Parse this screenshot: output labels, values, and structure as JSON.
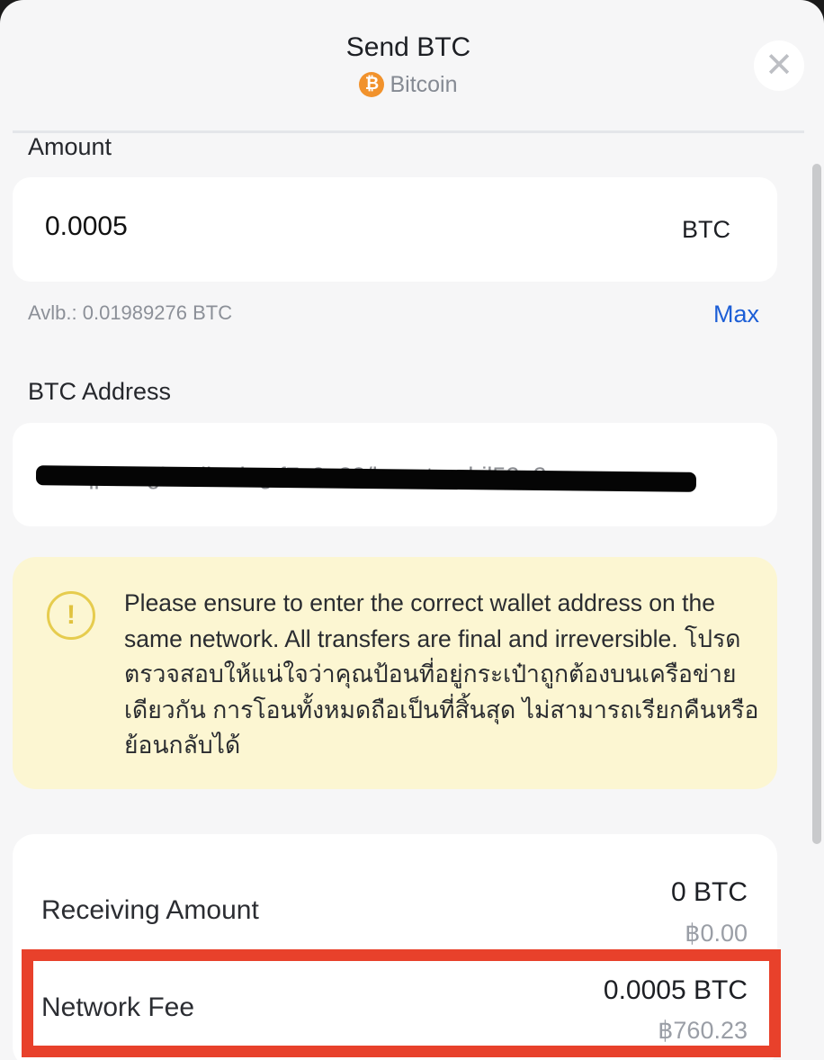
{
  "header": {
    "title": "Send BTC",
    "coin_symbol": "₿",
    "network_name": "Bitcoin",
    "close_glyph": "✕"
  },
  "amount": {
    "label": "Amount",
    "value": "0.0005",
    "unit": "BTC",
    "available": "Avlb.: 0.01989276 BTC",
    "max_label": "Max"
  },
  "address": {
    "label": "BTC Address",
    "value": "bc1qpz89gbxtdkedegtf7z2e33/buentpprbjl52g2"
  },
  "warning": {
    "icon_glyph": "!",
    "text": "Please ensure to enter the correct wallet address on the same network. All transfers are final and irreversible. โปรดตรวจสอบให้แน่ใจว่าคุณป้อนที่อยู่กระเป๋าถูกต้องบนเครือข่ายเดียวกัน การโอนทั้งหมดถือเป็นที่สิ้นสุด ไม่สามารถเรียกคืนหรือย้อนกลับได้"
  },
  "summary": {
    "receiving_label": "Receiving Amount",
    "receiving_btc": "0 BTC",
    "receiving_thb": "฿0.00",
    "fee_label": "Network Fee",
    "fee_btc": "0.0005 BTC",
    "fee_thb": "฿760.23"
  },
  "colors": {
    "accent_link": "#1c5ed6",
    "coin": "#f1922c",
    "warning_bg": "#fcf6d2",
    "highlight": "#e8412b"
  }
}
